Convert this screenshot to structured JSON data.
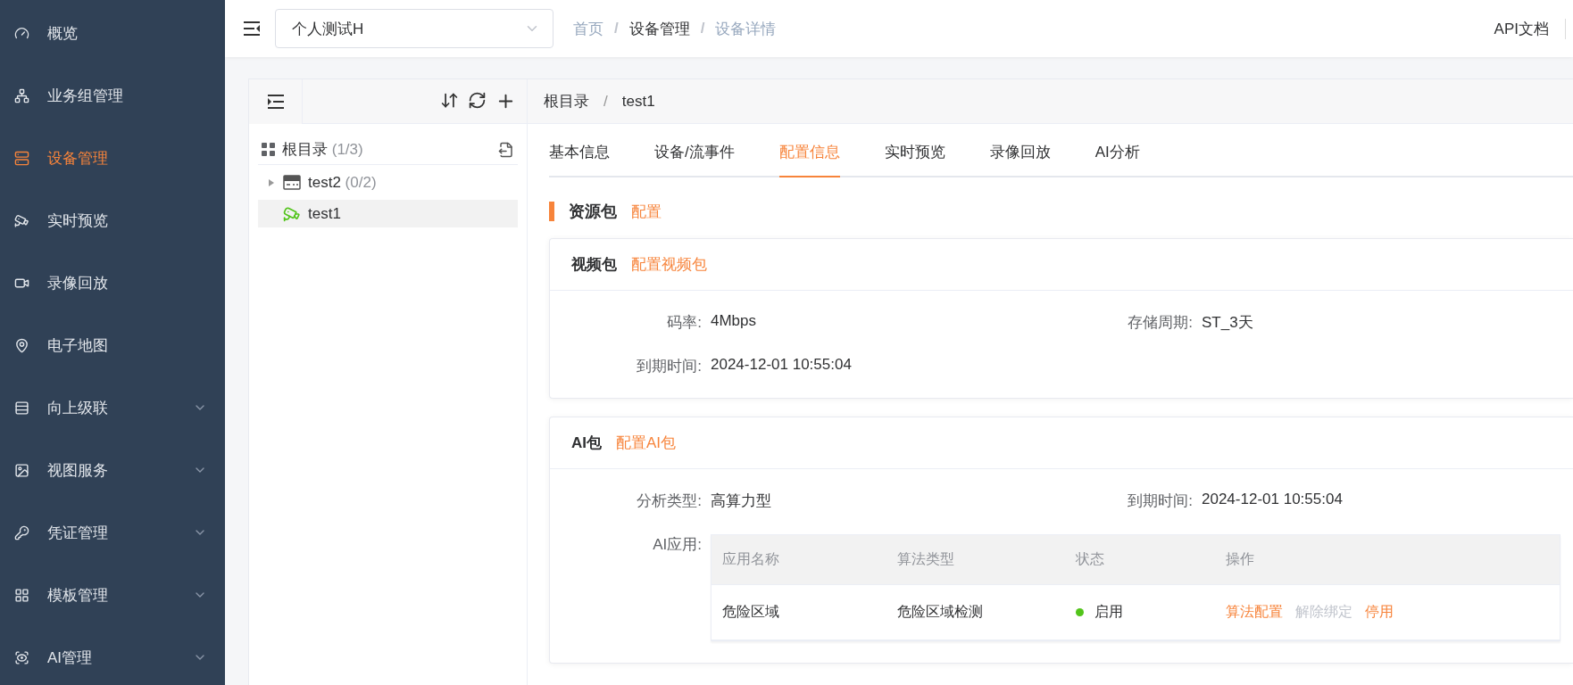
{
  "sidebar": {
    "items": [
      {
        "label": "概览",
        "selected": false,
        "submenu": false
      },
      {
        "label": "业务组管理",
        "selected": false,
        "submenu": false
      },
      {
        "label": "设备管理",
        "selected": true,
        "submenu": false
      },
      {
        "label": "实时预览",
        "selected": false,
        "submenu": false
      },
      {
        "label": "录像回放",
        "selected": false,
        "submenu": false
      },
      {
        "label": "电子地图",
        "selected": false,
        "submenu": false
      },
      {
        "label": "向上级联",
        "selected": false,
        "submenu": true
      },
      {
        "label": "视图服务",
        "selected": false,
        "submenu": true
      },
      {
        "label": "凭证管理",
        "selected": false,
        "submenu": true
      },
      {
        "label": "模板管理",
        "selected": false,
        "submenu": true
      },
      {
        "label": "AI管理",
        "selected": false,
        "submenu": true
      }
    ]
  },
  "header": {
    "project_select": {
      "value": "个人测试H"
    },
    "breadcrumb": [
      {
        "label": "首页",
        "selected": false
      },
      {
        "label": "设备管理",
        "selected": true
      },
      {
        "label": "设备详情",
        "selected": false
      }
    ],
    "separator": "/",
    "links": [
      "API文档"
    ]
  },
  "tree": {
    "root": {
      "label": "根目录",
      "count": "(1/3)"
    },
    "nodes": [
      {
        "label": "test2",
        "count": "(0/2)",
        "kind": "nvr",
        "expanded": false,
        "selected": false
      },
      {
        "label": "test1",
        "kind": "camera",
        "selected": true
      }
    ]
  },
  "detail": {
    "path": [
      "根目录",
      "test1"
    ],
    "path_separator": "/",
    "tabs": [
      {
        "label": "基本信息",
        "selected": false
      },
      {
        "label": "设备/流事件",
        "selected": false
      },
      {
        "label": "配置信息",
        "selected": true
      },
      {
        "label": "实时预览",
        "selected": false
      },
      {
        "label": "录像回放",
        "selected": false
      },
      {
        "label": "AI分析",
        "selected": false
      }
    ],
    "section": {
      "title": "资源包",
      "action": "配置"
    },
    "video_package": {
      "title": "视频包",
      "action": "配置视频包",
      "fields": [
        {
          "label": "码率:",
          "value": "4Mbps"
        },
        {
          "label": "存储周期:",
          "value": "ST_3天"
        },
        {
          "label": "到期时间:",
          "value": "2024-12-01 10:55:04"
        }
      ]
    },
    "ai_package": {
      "title": "AI包",
      "action": "配置AI包",
      "fields": [
        {
          "label": "分析类型:",
          "value": "高算力型"
        },
        {
          "label": "到期时间:",
          "value": "2024-12-01 10:55:04"
        }
      ],
      "apps_label": "AI应用:",
      "table": {
        "columns": [
          "应用名称",
          "算法类型",
          "状态",
          "操作"
        ],
        "rows": [
          {
            "name": "危险区域",
            "algorithm": "危险区域检测",
            "status": {
              "text": "启用",
              "color": "#52c41a"
            },
            "actions": [
              {
                "label": "算法配置",
                "disabled": false
              },
              {
                "label": "解除绑定",
                "disabled": true
              },
              {
                "label": "停用",
                "disabled": false
              }
            ]
          }
        ]
      }
    }
  }
}
